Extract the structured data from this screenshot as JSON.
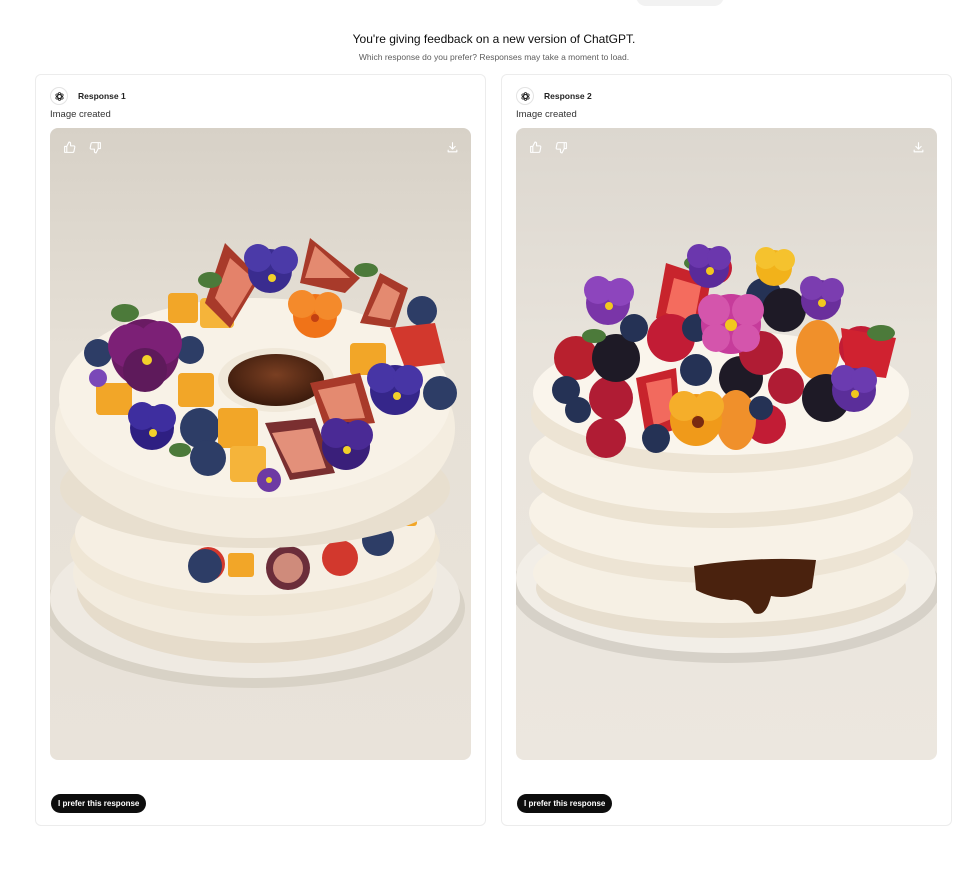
{
  "header": {
    "title": "You're giving feedback on a new version of ChatGPT.",
    "subtitle": "Which response do you prefer? Responses may take a moment to load."
  },
  "responses": [
    {
      "label": "Response 1",
      "status": "Image created",
      "prefer_label": "I prefer this response",
      "icons": [
        "openai-logo-icon",
        "thumbs-up-icon",
        "thumbs-down-icon",
        "download-icon"
      ]
    },
    {
      "label": "Response 2",
      "status": "Image created",
      "prefer_label": "I prefer this response",
      "icons": [
        "openai-logo-icon",
        "thumbs-up-icon",
        "thumbs-down-icon",
        "download-icon"
      ]
    }
  ]
}
